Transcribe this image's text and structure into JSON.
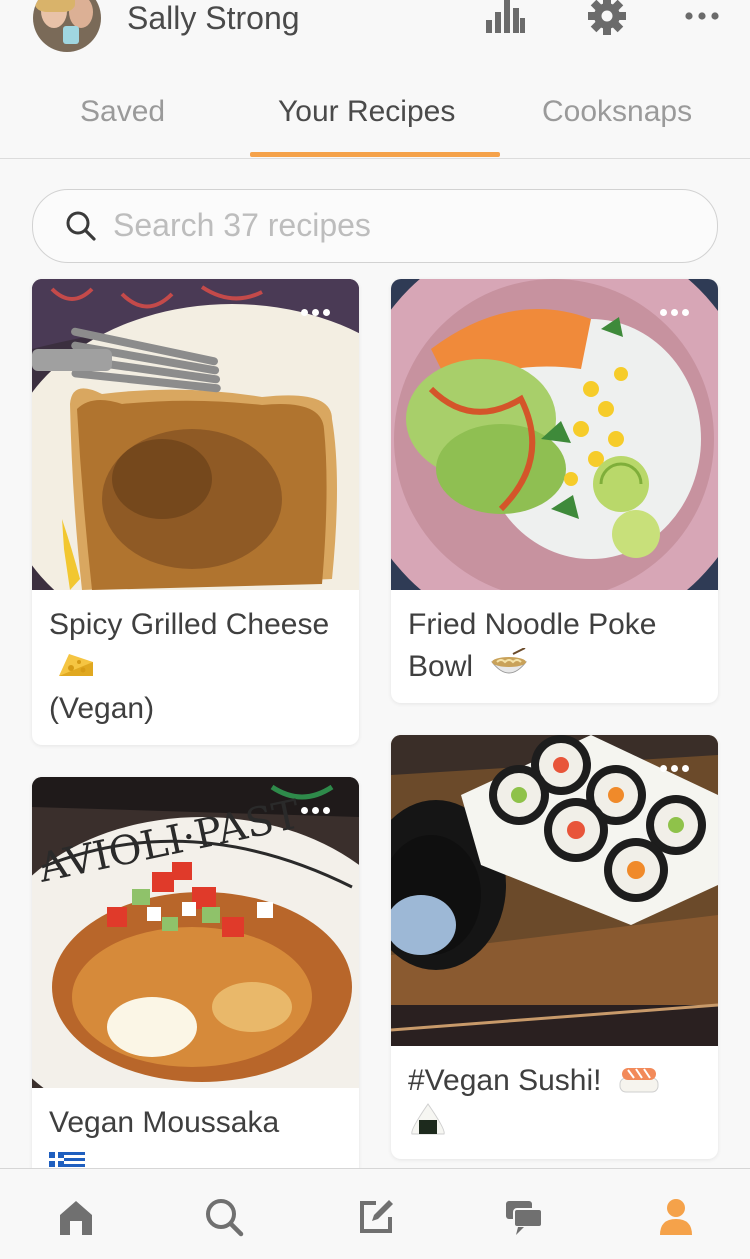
{
  "header": {
    "username": "Sally Strong",
    "icons": [
      "stats-icon",
      "gear-icon",
      "more-icon"
    ]
  },
  "tabs": [
    {
      "label": "Saved",
      "active": false
    },
    {
      "label": "Your Recipes",
      "active": true
    },
    {
      "label": "Cooksnaps",
      "active": false
    }
  ],
  "search": {
    "placeholder": "Search 37 recipes",
    "value": ""
  },
  "recipes": [
    {
      "title": "Spicy Grilled Cheese",
      "title_line2": "(Vegan)",
      "emoji": "cheese-emoji"
    },
    {
      "title": "Fried Noodle Poke Bowl",
      "emoji": "noodle-bowl-emoji"
    },
    {
      "title": "Vegan Moussaka",
      "emoji": "greek-flag-emoji"
    },
    {
      "title": "#Vegan Sushi!",
      "emoji": "sushi-emoji onigiri-emoji"
    }
  ],
  "bottom_nav": [
    "home-icon",
    "search-icon",
    "edit-icon",
    "chat-icon",
    "profile-icon"
  ],
  "colors": {
    "accent": "#f5a24a",
    "text": "#4a4a4a",
    "muted": "#9a9a9a",
    "background": "#f8f8f8"
  }
}
